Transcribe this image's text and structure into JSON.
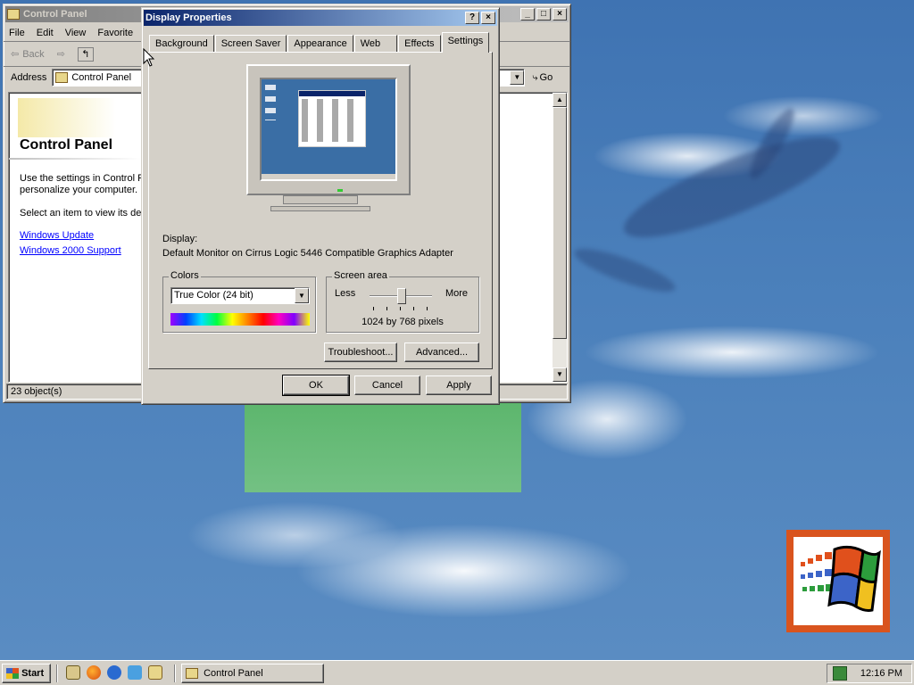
{
  "control_panel": {
    "title": "Control Panel",
    "menu": [
      "File",
      "Edit",
      "View",
      "Favorite"
    ],
    "toolbar": {
      "back_label": "Back"
    },
    "address": {
      "label": "Address",
      "value": "Control Panel",
      "go_label": "Go"
    },
    "heading": "Control Panel",
    "desc1": "Use the settings in Control P",
    "desc2": "personalize your computer.",
    "desc3": "Select an item to view its des",
    "links": [
      "Windows Update",
      "Windows 2000 Support"
    ],
    "status": "23 object(s)"
  },
  "display_properties": {
    "title": "Display Properties",
    "tabs": [
      "Background",
      "Screen Saver",
      "Appearance",
      "Web",
      "Effects",
      "Settings"
    ],
    "display_label": "Display:",
    "display_value": "Default Monitor on Cirrus Logic 5446 Compatible Graphics Adapter",
    "colors": {
      "group_label": "Colors",
      "selected": "True Color (24 bit)"
    },
    "screen_area": {
      "group_label": "Screen area",
      "less": "Less",
      "more": "More",
      "value": "1024 by 768 pixels"
    },
    "troubleshoot_label": "Troubleshoot...",
    "advanced_label": "Advanced...",
    "ok_label": "OK",
    "cancel_label": "Cancel",
    "apply_label": "Apply"
  },
  "taskbar": {
    "start_label": "Start",
    "task_label": "Control Panel",
    "clock": "12:16 PM"
  }
}
